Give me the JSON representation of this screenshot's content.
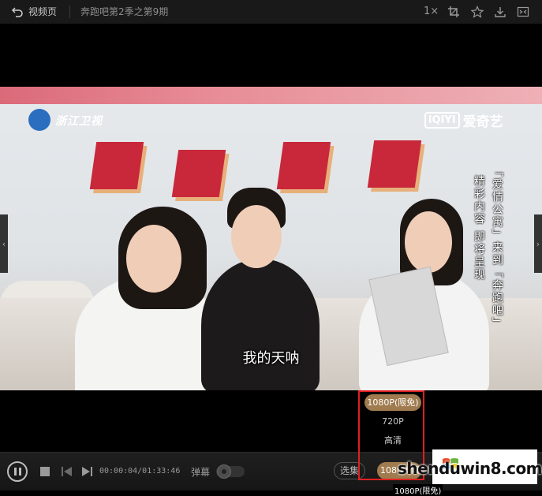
{
  "topbar": {
    "back_label": "视频页",
    "title": "奔跑吧第2季之第9期",
    "speed": "1×",
    "icons": [
      "crop-icon",
      "star-icon",
      "download-icon",
      "fullscreen-exit-icon"
    ]
  },
  "video": {
    "channel_logo": "浙江卫视",
    "iqiyi_box": "iQIYI",
    "iqiyi_text": "爱奇艺",
    "promo_col1": "「爱情公寓」来到「奔跑吧」",
    "promo_col2": "精彩内容 即将呈现",
    "subtitle": "我的天呐"
  },
  "quality_menu": {
    "options": [
      {
        "label": "1080P(限免)",
        "active": true
      },
      {
        "label": "720P",
        "active": false
      },
      {
        "label": "高清",
        "active": false
      }
    ]
  },
  "controls": {
    "time": "00:00:04/01:33:46",
    "danmu_label": "弹幕",
    "episodes_label": "选集",
    "quality_label": "1080P(限免)",
    "quality_tooltip": "1080P(限免)"
  },
  "watermark": {
    "site": "shenduwin8.com"
  },
  "colors": {
    "accent": "#a07b4f",
    "highlight_border": "#e02020"
  }
}
